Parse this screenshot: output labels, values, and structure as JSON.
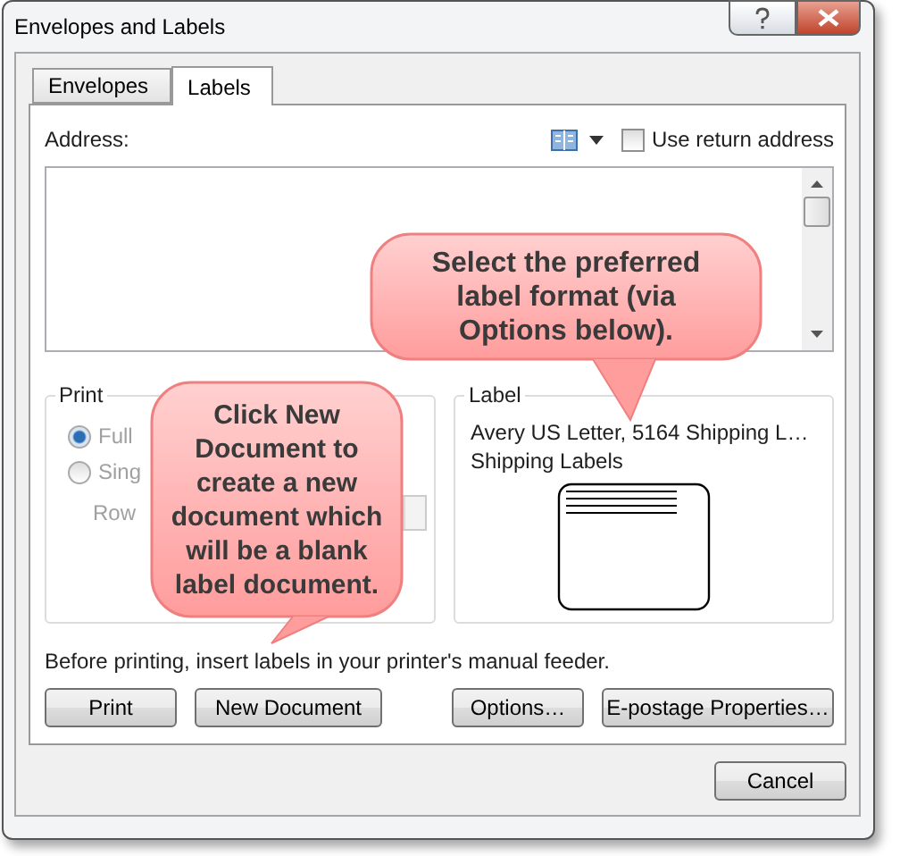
{
  "window": {
    "title": "Envelopes and Labels"
  },
  "tabs": [
    {
      "label": "Envelopes",
      "selected": false
    },
    {
      "label": "Labels",
      "selected": true
    }
  ],
  "address": {
    "label": "Address:",
    "use_return_address": {
      "label": "Use return address",
      "checked": false
    }
  },
  "print_group": {
    "title": "Print",
    "options": [
      {
        "label": "Full",
        "selected": true,
        "disabled": true
      },
      {
        "label": "Sing",
        "selected": false,
        "disabled": true
      }
    ],
    "row_label": "Row"
  },
  "label_group": {
    "title": "Label",
    "product": "Avery US Letter, 5164 Shipping L…",
    "description": "Shipping Labels"
  },
  "note": "Before printing, insert labels in your printer's manual feeder.",
  "buttons": [
    "Print",
    "New Document",
    "Options…",
    "E-postage Properties…"
  ],
  "cancel": "Cancel",
  "callouts": [
    {
      "text": "Select the preferred label format (via Options below)."
    },
    {
      "text": "Click New Document to create a new document which will be a blank label document."
    }
  ]
}
